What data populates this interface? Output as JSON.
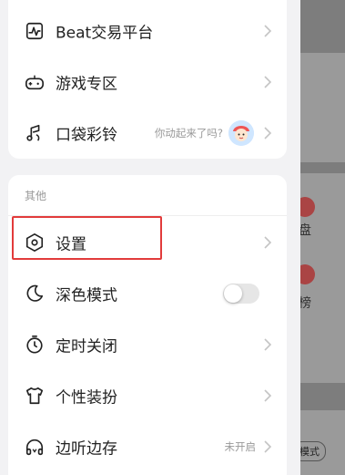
{
  "background_app": {
    "label_1": "盘",
    "label_2": "榜",
    "pill": "模式"
  },
  "menu_top": [
    {
      "label": "Beat交易平台",
      "icon": "beat-wave-icon"
    },
    {
      "label": "游戏专区",
      "icon": "gamepad-icon"
    },
    {
      "label": "口袋彩铃",
      "icon": "music-note-icon",
      "hint": "你动起来了吗?"
    }
  ],
  "section_other": {
    "title": "其他",
    "items": [
      {
        "label": "设置",
        "icon": "settings-hexagon-icon"
      },
      {
        "label": "深色模式",
        "icon": "moon-icon",
        "toggle_on": false
      },
      {
        "label": "定时关闭",
        "icon": "timer-icon"
      },
      {
        "label": "个性装扮",
        "icon": "tshirt-icon"
      },
      {
        "label": "边听边存",
        "icon": "headphones-icon",
        "status": "未开启"
      }
    ]
  },
  "colors": {
    "highlight": "#e23b3b",
    "background": "#f2f2f4"
  }
}
